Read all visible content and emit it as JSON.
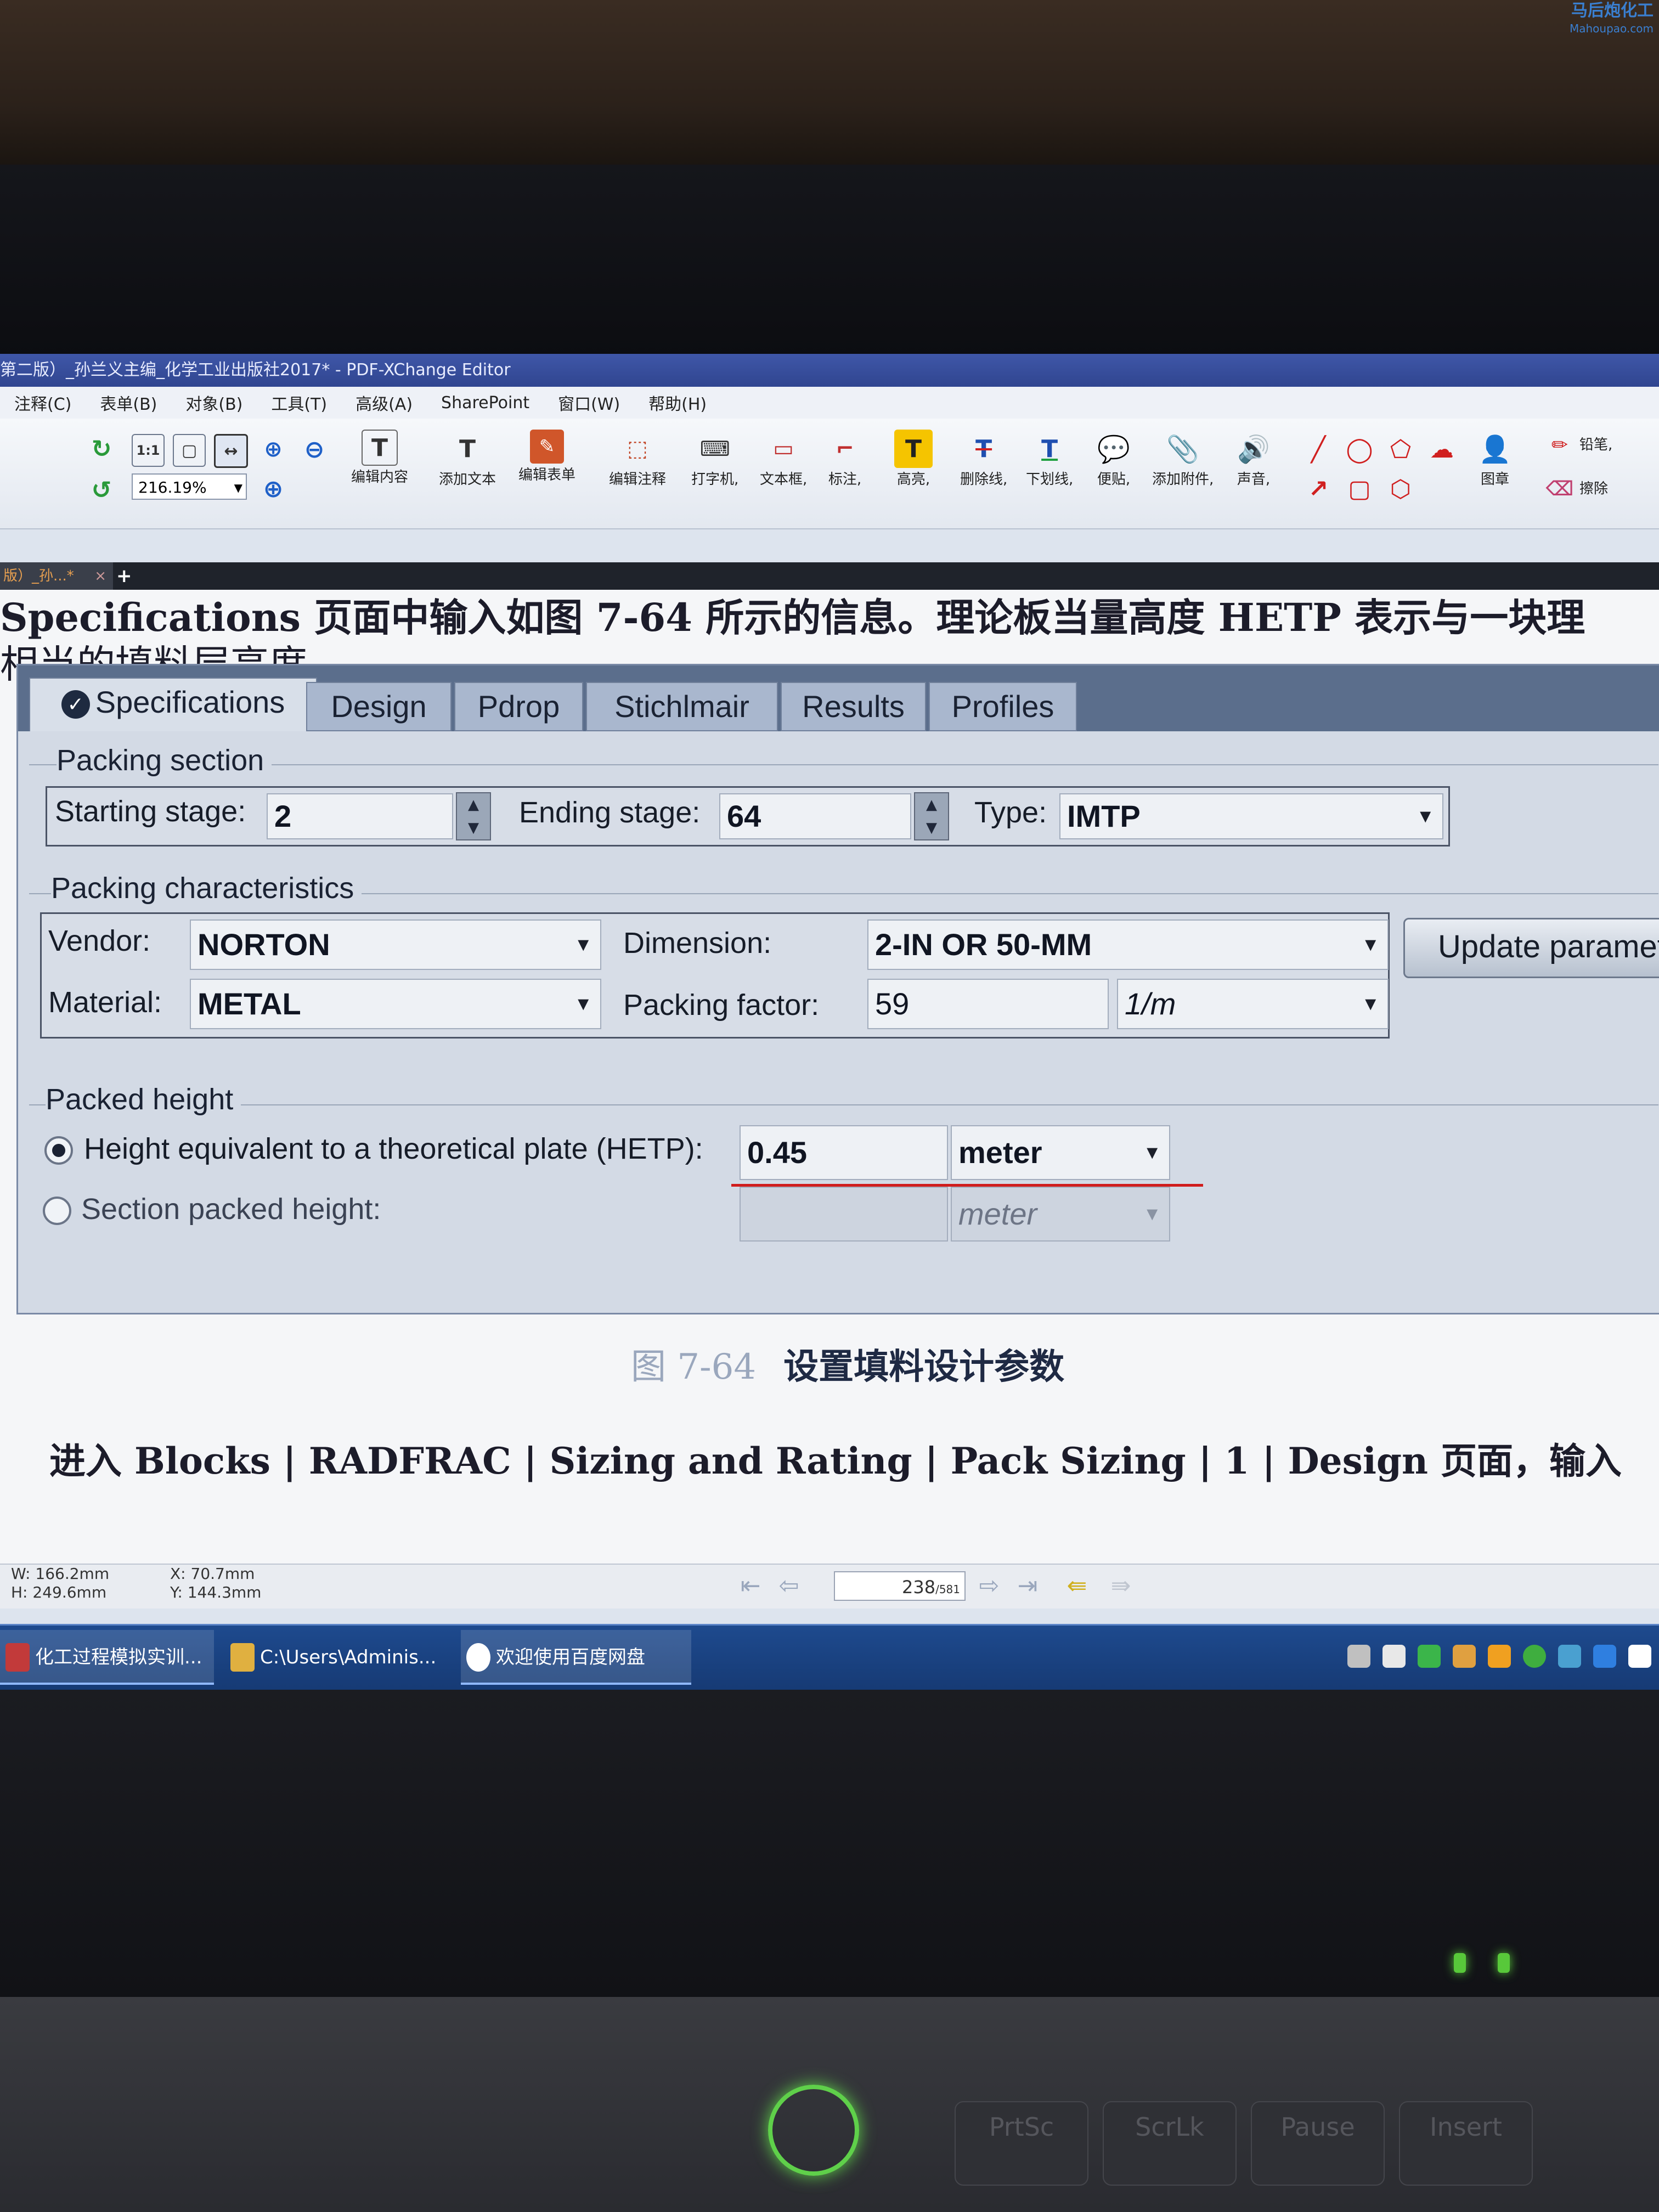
{
  "watermark": {
    "line1": "马后炮化工",
    "line2": "Mahoupao.com"
  },
  "window": {
    "title": "第二版）_孙兰义主编_化学工业出版社2017* - PDF-XChange Editor",
    "menu": [
      "注释(C)",
      "表单(B)",
      "对象(B)",
      "工具(T)",
      "高级(A)",
      "SharePoint",
      "窗口(W)",
      "帮助(H)"
    ],
    "zoom": "216.19%",
    "toolbar": {
      "edit_content": "编辑内容",
      "add_text": "添加文本",
      "edit_form": "编辑表单",
      "edit_annot": "编辑注释",
      "typewriter": "打字机,",
      "textbox": "文本框,",
      "callout": "标注,",
      "highlight": "高亮,",
      "strikeout": "删除线,",
      "underline": "下划线,",
      "sticky": "便贴,",
      "attach": "添加附件,",
      "sound": "声音,",
      "stamp": "图章",
      "pencil": "铅笔,",
      "eraser": "擦除"
    },
    "doc_tab": "版）_孙...*"
  },
  "document": {
    "line1": "Specifications 页面中输入如图 7-64 所示的信息。理论板当量高度 HETP 表示与一块理",
    "line2": "相当的填料层高度。",
    "caption_num": "图 7-64",
    "caption_text": "设置填料设计参数",
    "bottom_line": "进入 Blocks | RADFRAC | Sizing and Rating | Pack Sizing | 1 | Design 页面，输入"
  },
  "figure": {
    "tabs": [
      "Specifications",
      "Design",
      "Pdrop",
      "Stichlmair",
      "Results",
      "Profiles"
    ],
    "packing_section": {
      "title": "Packing section",
      "starting_stage_label": "Starting stage:",
      "starting_stage": "2",
      "ending_stage_label": "Ending stage:",
      "ending_stage": "64",
      "type_label": "Type:",
      "type": "IMTP"
    },
    "packing_characteristics": {
      "title": "Packing characteristics",
      "vendor_label": "Vendor:",
      "vendor": "NORTON",
      "dimension_label": "Dimension:",
      "dimension": "2-IN OR 50-MM",
      "material_label": "Material:",
      "material": "METAL",
      "packing_factor_label": "Packing factor:",
      "packing_factor": "59",
      "packing_factor_unit": "1/m",
      "update_button": "Update parameters"
    },
    "packed_height": {
      "title": "Packed height",
      "hetp_label": "Height equivalent to a theoretical plate (HETP):",
      "hetp_value": "0.45",
      "hetp_unit": "meter",
      "section_label": "Section packed height:",
      "section_value": "",
      "section_unit": "meter"
    }
  },
  "statusbar": {
    "w": "W: 166.2mm",
    "h": "H: 249.6mm",
    "x": "X:   70.7mm",
    "y": "Y: 144.3mm",
    "page": "238",
    "page_total": "/581"
  },
  "taskbar": {
    "tasks": [
      "化工过程模拟实训...",
      "C:\\Users\\Adminis...",
      "欢迎使用百度网盘"
    ]
  },
  "keyboard": {
    "keys": [
      "PrtSc",
      "ScrLk",
      "Pause",
      "Insert"
    ]
  }
}
